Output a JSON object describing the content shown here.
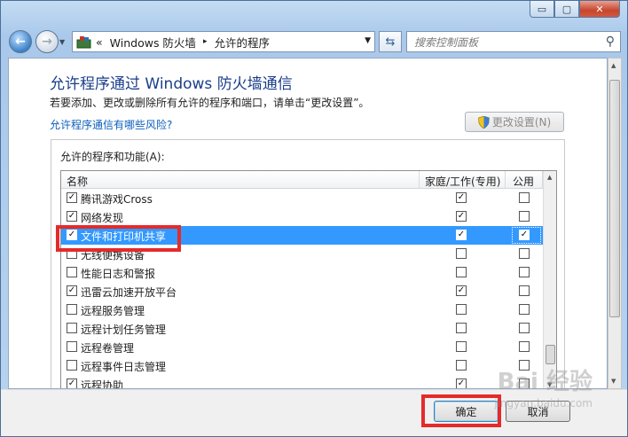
{
  "window": {
    "min": "▭",
    "max": "▢",
    "close": "✕"
  },
  "address": {
    "prefix": "«",
    "path": [
      "Windows 防火墙",
      "允许的程序"
    ],
    "separator": "▸",
    "drop": "▼"
  },
  "search": {
    "placeholder": "搜索控制面板",
    "icon": "search-icon"
  },
  "page": {
    "title": "允许程序通过 Windows 防火墙通信",
    "description": "若要添加、更改或删除所有允许的程序和端口，请单击“更改设置”。",
    "risk_link": "允许程序通信有哪些风险?",
    "change_settings": "更改设置(N)"
  },
  "group": {
    "label": "允许的程序和功能(A):",
    "columns": {
      "name": "名称",
      "home": "家庭/工作(专用)",
      "public": "公用"
    },
    "rows": [
      {
        "name": "腾讯游戏Cross",
        "enabled": true,
        "home": true,
        "public": false
      },
      {
        "name": "网络发现",
        "enabled": true,
        "home": true,
        "public": false
      },
      {
        "name": "文件和打印机共享",
        "enabled": true,
        "home": true,
        "public": true,
        "selected": true
      },
      {
        "name": "无线便携设备",
        "enabled": false,
        "home": false,
        "public": false
      },
      {
        "name": "性能日志和警报",
        "enabled": false,
        "home": false,
        "public": false
      },
      {
        "name": "迅雷云加速开放平台",
        "enabled": true,
        "home": true,
        "public": false
      },
      {
        "name": "远程服务管理",
        "enabled": false,
        "home": false,
        "public": false
      },
      {
        "name": "远程计划任务管理",
        "enabled": false,
        "home": false,
        "public": false
      },
      {
        "name": "远程卷管理",
        "enabled": false,
        "home": false,
        "public": false
      },
      {
        "name": "远程事件日志管理",
        "enabled": false,
        "home": false,
        "public": false
      },
      {
        "name": "远程协助",
        "enabled": true,
        "home": true,
        "public": false
      }
    ]
  },
  "footer": {
    "ok": "确定",
    "cancel": "取消"
  },
  "watermark": {
    "text": "Bai 经验",
    "sub": "jingyan.baidu.com"
  },
  "colors": {
    "selection": "#3399ff",
    "highlight_box": "#e52a2a",
    "link": "#0d5fbd"
  }
}
